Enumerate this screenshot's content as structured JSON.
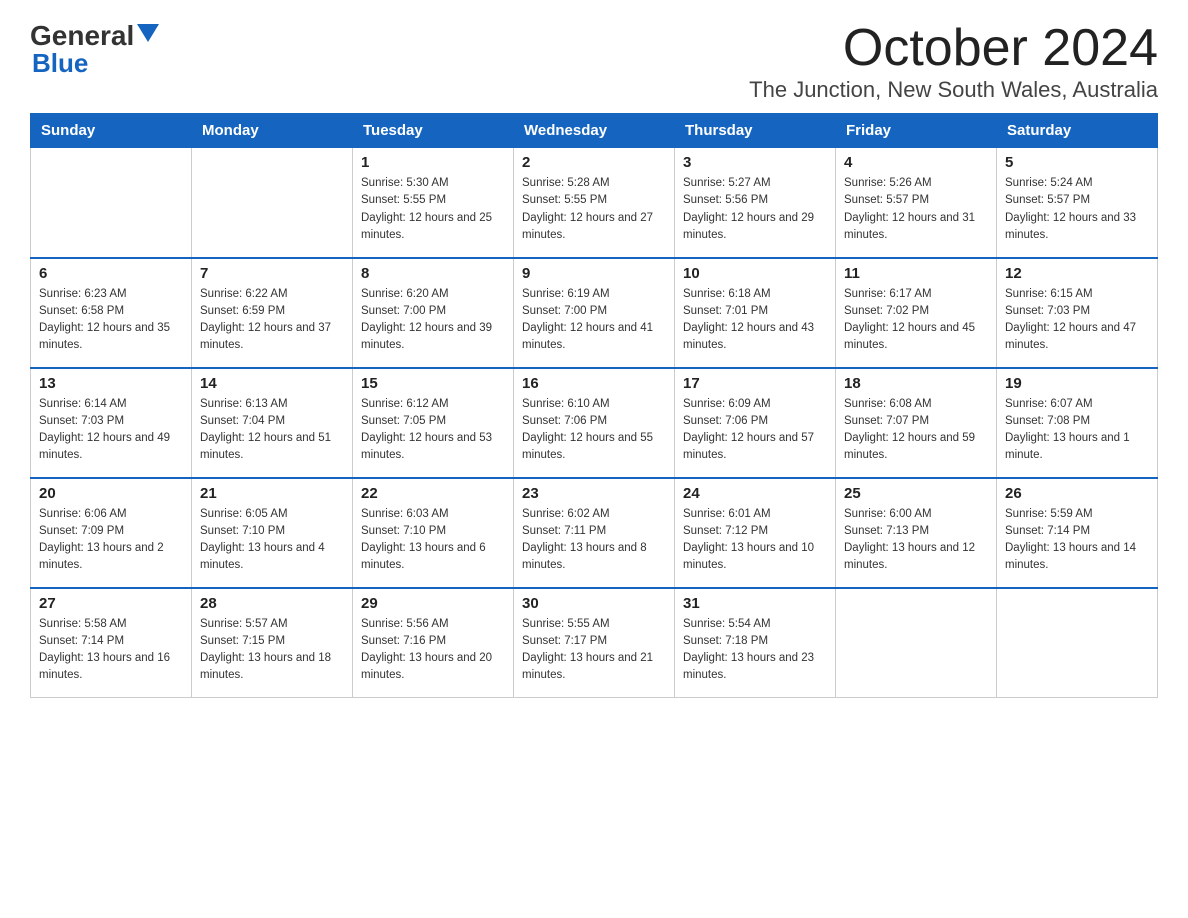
{
  "header": {
    "logo_general": "General",
    "logo_blue": "Blue",
    "month_title": "October 2024",
    "location": "The Junction, New South Wales, Australia"
  },
  "days_of_week": [
    "Sunday",
    "Monday",
    "Tuesday",
    "Wednesday",
    "Thursday",
    "Friday",
    "Saturday"
  ],
  "weeks": [
    [
      {
        "day": "",
        "sunrise": "",
        "sunset": "",
        "daylight": ""
      },
      {
        "day": "",
        "sunrise": "",
        "sunset": "",
        "daylight": ""
      },
      {
        "day": "1",
        "sunrise": "Sunrise: 5:30 AM",
        "sunset": "Sunset: 5:55 PM",
        "daylight": "Daylight: 12 hours and 25 minutes."
      },
      {
        "day": "2",
        "sunrise": "Sunrise: 5:28 AM",
        "sunset": "Sunset: 5:55 PM",
        "daylight": "Daylight: 12 hours and 27 minutes."
      },
      {
        "day": "3",
        "sunrise": "Sunrise: 5:27 AM",
        "sunset": "Sunset: 5:56 PM",
        "daylight": "Daylight: 12 hours and 29 minutes."
      },
      {
        "day": "4",
        "sunrise": "Sunrise: 5:26 AM",
        "sunset": "Sunset: 5:57 PM",
        "daylight": "Daylight: 12 hours and 31 minutes."
      },
      {
        "day": "5",
        "sunrise": "Sunrise: 5:24 AM",
        "sunset": "Sunset: 5:57 PM",
        "daylight": "Daylight: 12 hours and 33 minutes."
      }
    ],
    [
      {
        "day": "6",
        "sunrise": "Sunrise: 6:23 AM",
        "sunset": "Sunset: 6:58 PM",
        "daylight": "Daylight: 12 hours and 35 minutes."
      },
      {
        "day": "7",
        "sunrise": "Sunrise: 6:22 AM",
        "sunset": "Sunset: 6:59 PM",
        "daylight": "Daylight: 12 hours and 37 minutes."
      },
      {
        "day": "8",
        "sunrise": "Sunrise: 6:20 AM",
        "sunset": "Sunset: 7:00 PM",
        "daylight": "Daylight: 12 hours and 39 minutes."
      },
      {
        "day": "9",
        "sunrise": "Sunrise: 6:19 AM",
        "sunset": "Sunset: 7:00 PM",
        "daylight": "Daylight: 12 hours and 41 minutes."
      },
      {
        "day": "10",
        "sunrise": "Sunrise: 6:18 AM",
        "sunset": "Sunset: 7:01 PM",
        "daylight": "Daylight: 12 hours and 43 minutes."
      },
      {
        "day": "11",
        "sunrise": "Sunrise: 6:17 AM",
        "sunset": "Sunset: 7:02 PM",
        "daylight": "Daylight: 12 hours and 45 minutes."
      },
      {
        "day": "12",
        "sunrise": "Sunrise: 6:15 AM",
        "sunset": "Sunset: 7:03 PM",
        "daylight": "Daylight: 12 hours and 47 minutes."
      }
    ],
    [
      {
        "day": "13",
        "sunrise": "Sunrise: 6:14 AM",
        "sunset": "Sunset: 7:03 PM",
        "daylight": "Daylight: 12 hours and 49 minutes."
      },
      {
        "day": "14",
        "sunrise": "Sunrise: 6:13 AM",
        "sunset": "Sunset: 7:04 PM",
        "daylight": "Daylight: 12 hours and 51 minutes."
      },
      {
        "day": "15",
        "sunrise": "Sunrise: 6:12 AM",
        "sunset": "Sunset: 7:05 PM",
        "daylight": "Daylight: 12 hours and 53 minutes."
      },
      {
        "day": "16",
        "sunrise": "Sunrise: 6:10 AM",
        "sunset": "Sunset: 7:06 PM",
        "daylight": "Daylight: 12 hours and 55 minutes."
      },
      {
        "day": "17",
        "sunrise": "Sunrise: 6:09 AM",
        "sunset": "Sunset: 7:06 PM",
        "daylight": "Daylight: 12 hours and 57 minutes."
      },
      {
        "day": "18",
        "sunrise": "Sunrise: 6:08 AM",
        "sunset": "Sunset: 7:07 PM",
        "daylight": "Daylight: 12 hours and 59 minutes."
      },
      {
        "day": "19",
        "sunrise": "Sunrise: 6:07 AM",
        "sunset": "Sunset: 7:08 PM",
        "daylight": "Daylight: 13 hours and 1 minute."
      }
    ],
    [
      {
        "day": "20",
        "sunrise": "Sunrise: 6:06 AM",
        "sunset": "Sunset: 7:09 PM",
        "daylight": "Daylight: 13 hours and 2 minutes."
      },
      {
        "day": "21",
        "sunrise": "Sunrise: 6:05 AM",
        "sunset": "Sunset: 7:10 PM",
        "daylight": "Daylight: 13 hours and 4 minutes."
      },
      {
        "day": "22",
        "sunrise": "Sunrise: 6:03 AM",
        "sunset": "Sunset: 7:10 PM",
        "daylight": "Daylight: 13 hours and 6 minutes."
      },
      {
        "day": "23",
        "sunrise": "Sunrise: 6:02 AM",
        "sunset": "Sunset: 7:11 PM",
        "daylight": "Daylight: 13 hours and 8 minutes."
      },
      {
        "day": "24",
        "sunrise": "Sunrise: 6:01 AM",
        "sunset": "Sunset: 7:12 PM",
        "daylight": "Daylight: 13 hours and 10 minutes."
      },
      {
        "day": "25",
        "sunrise": "Sunrise: 6:00 AM",
        "sunset": "Sunset: 7:13 PM",
        "daylight": "Daylight: 13 hours and 12 minutes."
      },
      {
        "day": "26",
        "sunrise": "Sunrise: 5:59 AM",
        "sunset": "Sunset: 7:14 PM",
        "daylight": "Daylight: 13 hours and 14 minutes."
      }
    ],
    [
      {
        "day": "27",
        "sunrise": "Sunrise: 5:58 AM",
        "sunset": "Sunset: 7:14 PM",
        "daylight": "Daylight: 13 hours and 16 minutes."
      },
      {
        "day": "28",
        "sunrise": "Sunrise: 5:57 AM",
        "sunset": "Sunset: 7:15 PM",
        "daylight": "Daylight: 13 hours and 18 minutes."
      },
      {
        "day": "29",
        "sunrise": "Sunrise: 5:56 AM",
        "sunset": "Sunset: 7:16 PM",
        "daylight": "Daylight: 13 hours and 20 minutes."
      },
      {
        "day": "30",
        "sunrise": "Sunrise: 5:55 AM",
        "sunset": "Sunset: 7:17 PM",
        "daylight": "Daylight: 13 hours and 21 minutes."
      },
      {
        "day": "31",
        "sunrise": "Sunrise: 5:54 AM",
        "sunset": "Sunset: 7:18 PM",
        "daylight": "Daylight: 13 hours and 23 minutes."
      },
      {
        "day": "",
        "sunrise": "",
        "sunset": "",
        "daylight": ""
      },
      {
        "day": "",
        "sunrise": "",
        "sunset": "",
        "daylight": ""
      }
    ]
  ]
}
